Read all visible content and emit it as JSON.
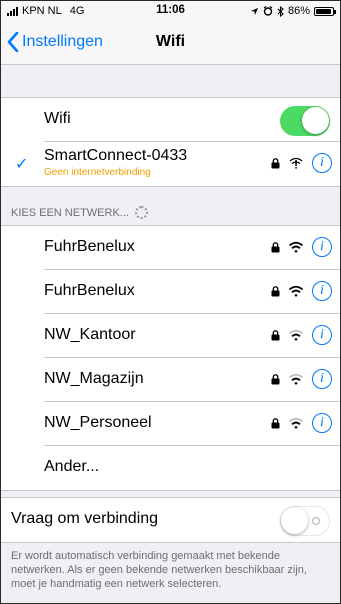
{
  "status_bar": {
    "carrier": "KPN NL",
    "network": "4G",
    "time": "11:06",
    "battery_percent": "86%",
    "battery_level": 0.86,
    "icons": [
      "location-arrow-icon",
      "alarm-icon",
      "bluetooth-icon"
    ]
  },
  "nav": {
    "back_label": "Instellingen",
    "title": "Wifi"
  },
  "wifi_toggle": {
    "label": "Wifi",
    "on": true
  },
  "connected": {
    "name": "SmartConnect-0433",
    "status": "Geen internetverbinding"
  },
  "choose_header": "KIES EEN NETWERK...",
  "networks": [
    {
      "name": "FuhrBenelux",
      "locked": true,
      "strength": 3
    },
    {
      "name": "FuhrBenelux",
      "locked": true,
      "strength": 3
    },
    {
      "name": "NW_Kantoor",
      "locked": true,
      "strength": 2
    },
    {
      "name": "NW_Magazijn",
      "locked": true,
      "strength": 2
    },
    {
      "name": "NW_Personeel",
      "locked": true,
      "strength": 2
    }
  ],
  "other_label": "Ander...",
  "ask_to_join": {
    "label": "Vraag om verbinding",
    "on": false,
    "footer": "Er wordt automatisch verbinding gemaakt met bekende netwerken. Als er geen bekende netwerken beschikbaar zijn, moet je handmatig een netwerk selecteren."
  },
  "colors": {
    "accent": "#007aff",
    "toggle_on": "#4cd964",
    "warning": "#f0a000"
  }
}
